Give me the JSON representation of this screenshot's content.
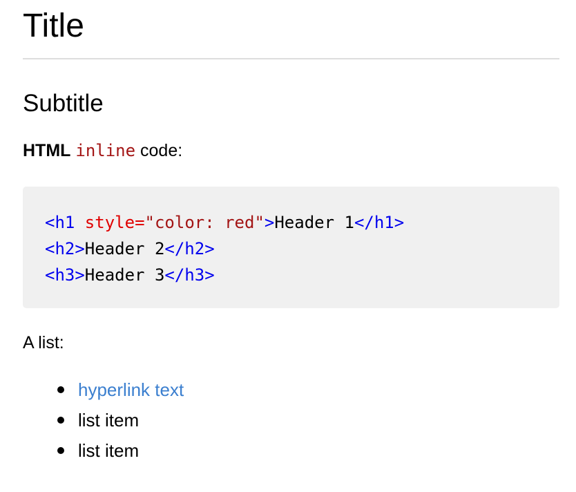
{
  "title": "Title",
  "subtitle": "Subtitle",
  "intro": {
    "bold": "HTML",
    "code": "inline",
    "rest": " code:"
  },
  "codeblock": {
    "line1": {
      "open_tag": "<h1",
      "attr_name": " style",
      "equals": "=",
      "attr_value": "\"color: red\"",
      "close_bracket": ">",
      "text": "Header 1",
      "end_tag": "</h1>"
    },
    "line2": {
      "open_tag": "<h2>",
      "text": "Header 2",
      "end_tag": "</h2>"
    },
    "line3": {
      "open_tag": "<h3>",
      "text": "Header 3",
      "end_tag": "</h3>"
    }
  },
  "list_intro": "A list:",
  "list_items": [
    {
      "label": "hyperlink text",
      "is_link": true
    },
    {
      "label": "list item",
      "is_link": false
    },
    {
      "label": "list item",
      "is_link": false
    }
  ],
  "colors": {
    "link": "#3b7fcf",
    "code_tag": "#0000ee",
    "code_attr": "#e00000",
    "code_string": "#a31515",
    "code_background": "#f0f0f0",
    "rule": "#dddddd"
  }
}
